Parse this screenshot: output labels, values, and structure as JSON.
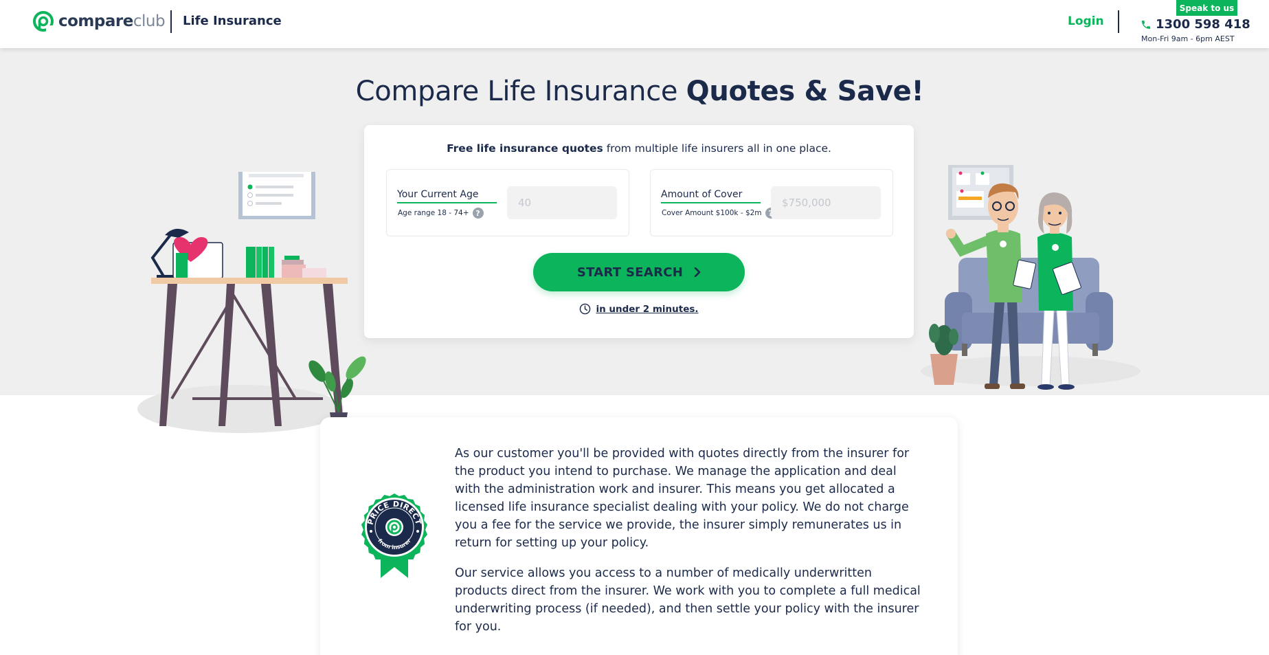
{
  "header": {
    "logo": {
      "bold": "compare",
      "light": "club"
    },
    "product_name": "Life Insurance",
    "login_label": "Login",
    "speak_badge": "Speak to us",
    "phone": "1300 598 418",
    "hours": "Mon-Fri 9am - 6pm AEST"
  },
  "hero": {
    "title_regular": "Compare Life Insurance ",
    "title_bold": "Quotes & Save!",
    "card": {
      "intro_bold": "Free life insurance quotes",
      "intro_rest": " from multiple life insurers all in one place.",
      "age": {
        "label": "Your Current Age",
        "help": "Age range 18 - 74+",
        "help_icon": "?",
        "placeholder": "40",
        "value": ""
      },
      "cover": {
        "label": "Amount of Cover",
        "help": "Cover Amount $100k - $2m",
        "help_icon": "?",
        "placeholder": "$750,000",
        "value": ""
      },
      "start_button": "START SEARCH",
      "time_note": "in under 2 minutes."
    }
  },
  "info": {
    "badge": {
      "top": "PRICE DIRECT",
      "bottom": "from insurer"
    },
    "paragraphs": [
      "As our customer you'll be provided with quotes directly from the insurer for the product you intend to purchase. We manage the application and deal with the administration work and insurer. This means you get allocated a licensed life insurance specialist dealing with your policy. We do not charge you a fee for the service we provide, the insurer simply remunerates us in return for setting up your policy.",
      "Our service allows you access to a number of medically underwritten products direct from the insurer. We work with you to complete a full medical underwriting process (if needed), and then settle your policy with the insurer for you."
    ]
  },
  "colors": {
    "brand_green": "#0cb45b",
    "navy": "#1b2a4a",
    "hero_bg": "#efefef"
  },
  "icons": [
    "compareclub-logo-icon",
    "phone-icon",
    "help-icon",
    "chevron-right-icon",
    "clock-icon",
    "price-direct-badge-icon"
  ]
}
